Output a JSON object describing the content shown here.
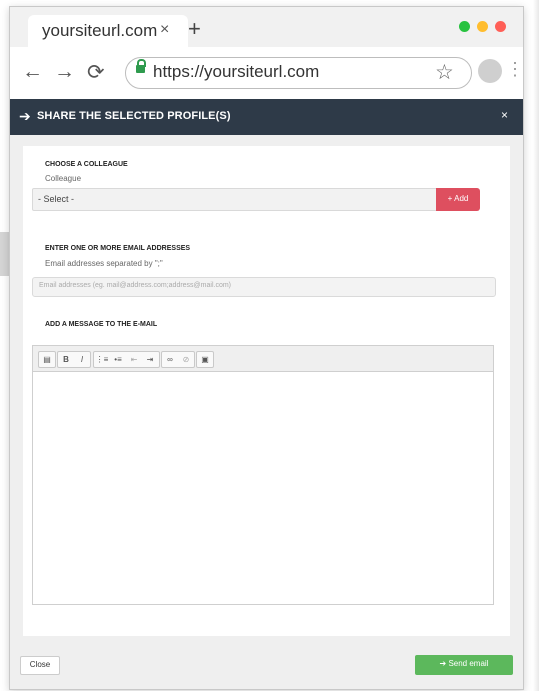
{
  "browser": {
    "tab_title": "yoursiteurl.com",
    "tab_close": "×",
    "new_tab": "+",
    "url": "https://yoursiteurl.com",
    "back": "←",
    "forward": "→",
    "reload": "⟳",
    "star": "☆",
    "menu": "⋮",
    "traffic_lights": [
      "#27c23f",
      "#ffbd2e",
      "#ff5f57"
    ]
  },
  "modal": {
    "title": "SHARE THE SELECTED PROFILE(S)",
    "header_icon": "arrow-right-icon",
    "close_symbol": "×",
    "colleague": {
      "section_title": "CHOOSE A COLLEAGUE",
      "label": "Colleague",
      "selected_value": "- Select -",
      "add_label": "+ Add"
    },
    "email": {
      "section_title": "ENTER ONE OR MORE EMAIL ADDRESSES",
      "label": "Email addresses separated by \";\"",
      "placeholder": "Email addresses (eg. mail@address.com;address@mail.com)"
    },
    "message": {
      "section_title": "ADD A MESSAGE TO THE E-MAIL",
      "toolbar_icons": [
        "paste-icon",
        "bold-icon",
        "italic-icon",
        "ordered-list-icon",
        "unordered-list-icon",
        "outdent-icon",
        "indent-icon",
        "link-icon",
        "unlink-icon",
        "image-icon"
      ]
    },
    "footer": {
      "close_label": "Close",
      "send_label": "➔ Send email"
    }
  },
  "colors": {
    "header_bg": "#2e3a48",
    "add_button": "#de4f5f",
    "send_button": "#5cb85c",
    "secure_lock": "#2f9b4e"
  }
}
